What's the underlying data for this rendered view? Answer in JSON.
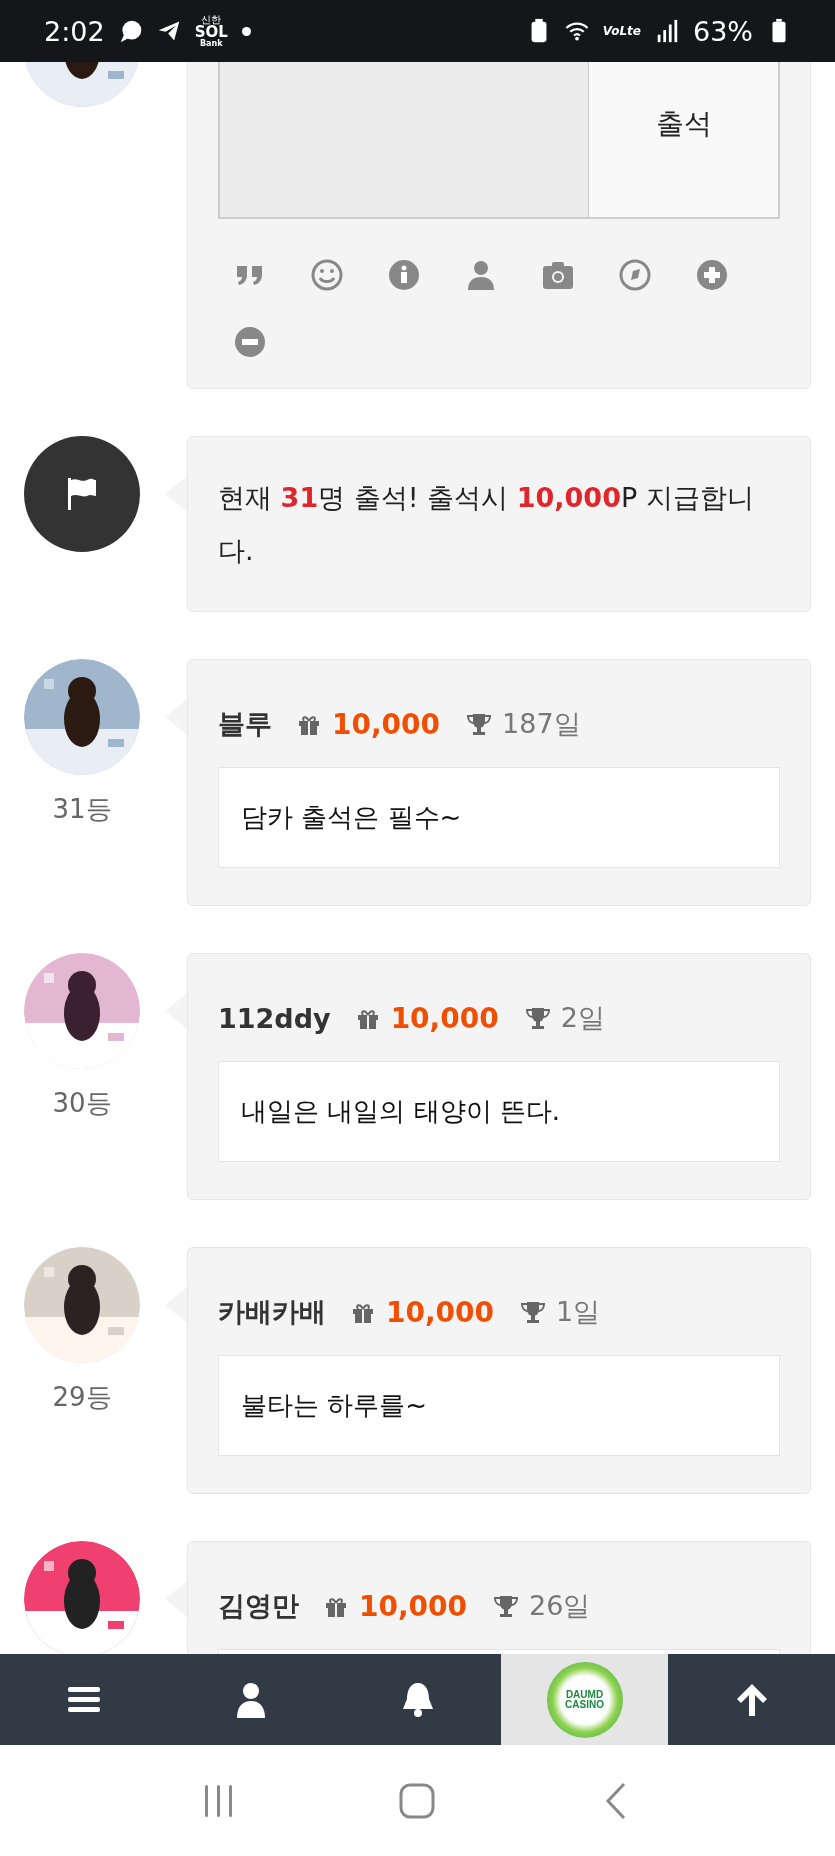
{
  "status_bar": {
    "time": "2:02",
    "bank_logo": [
      "신한",
      "SOL",
      "Bank"
    ],
    "network": "VoLte",
    "battery": "63%"
  },
  "composer": {
    "submit_button": "출석",
    "tools": [
      {
        "kind": "quote"
      },
      {
        "kind": "smile"
      },
      {
        "kind": "info"
      },
      {
        "kind": "user"
      },
      {
        "kind": "camera"
      },
      {
        "kind": "compass"
      },
      {
        "kind": "plus"
      },
      {
        "kind": "minus"
      }
    ]
  },
  "notice": {
    "text": "현재 **31**명 출석! 출석시 **10,000**P 지급합니다."
  },
  "entries": [
    {
      "name": "블루",
      "points": "10,000",
      "days": "187일",
      "rank": "31등",
      "message": "담카 출석은 필수~"
    },
    {
      "name": "112ddy",
      "points": "10,000",
      "days": "2일",
      "rank": "30등",
      "message": "내일은 내일의 태양이 뜬다."
    },
    {
      "name": "카배카배",
      "points": "10,000",
      "days": "1일",
      "rank": "29등",
      "message": "불타는 하루를~"
    },
    {
      "name": "김영만",
      "points": "10,000",
      "days": "26일"
    }
  ],
  "bottom_nav": [
    {
      "kind": "menu",
      "selected": false
    },
    {
      "kind": "user",
      "selected": false
    },
    {
      "kind": "bell",
      "selected": false
    },
    {
      "kind": "logo",
      "lines": [
        "DAUMD",
        "CASINO"
      ],
      "selected": true
    },
    {
      "kind": "top",
      "selected": false
    }
  ]
}
